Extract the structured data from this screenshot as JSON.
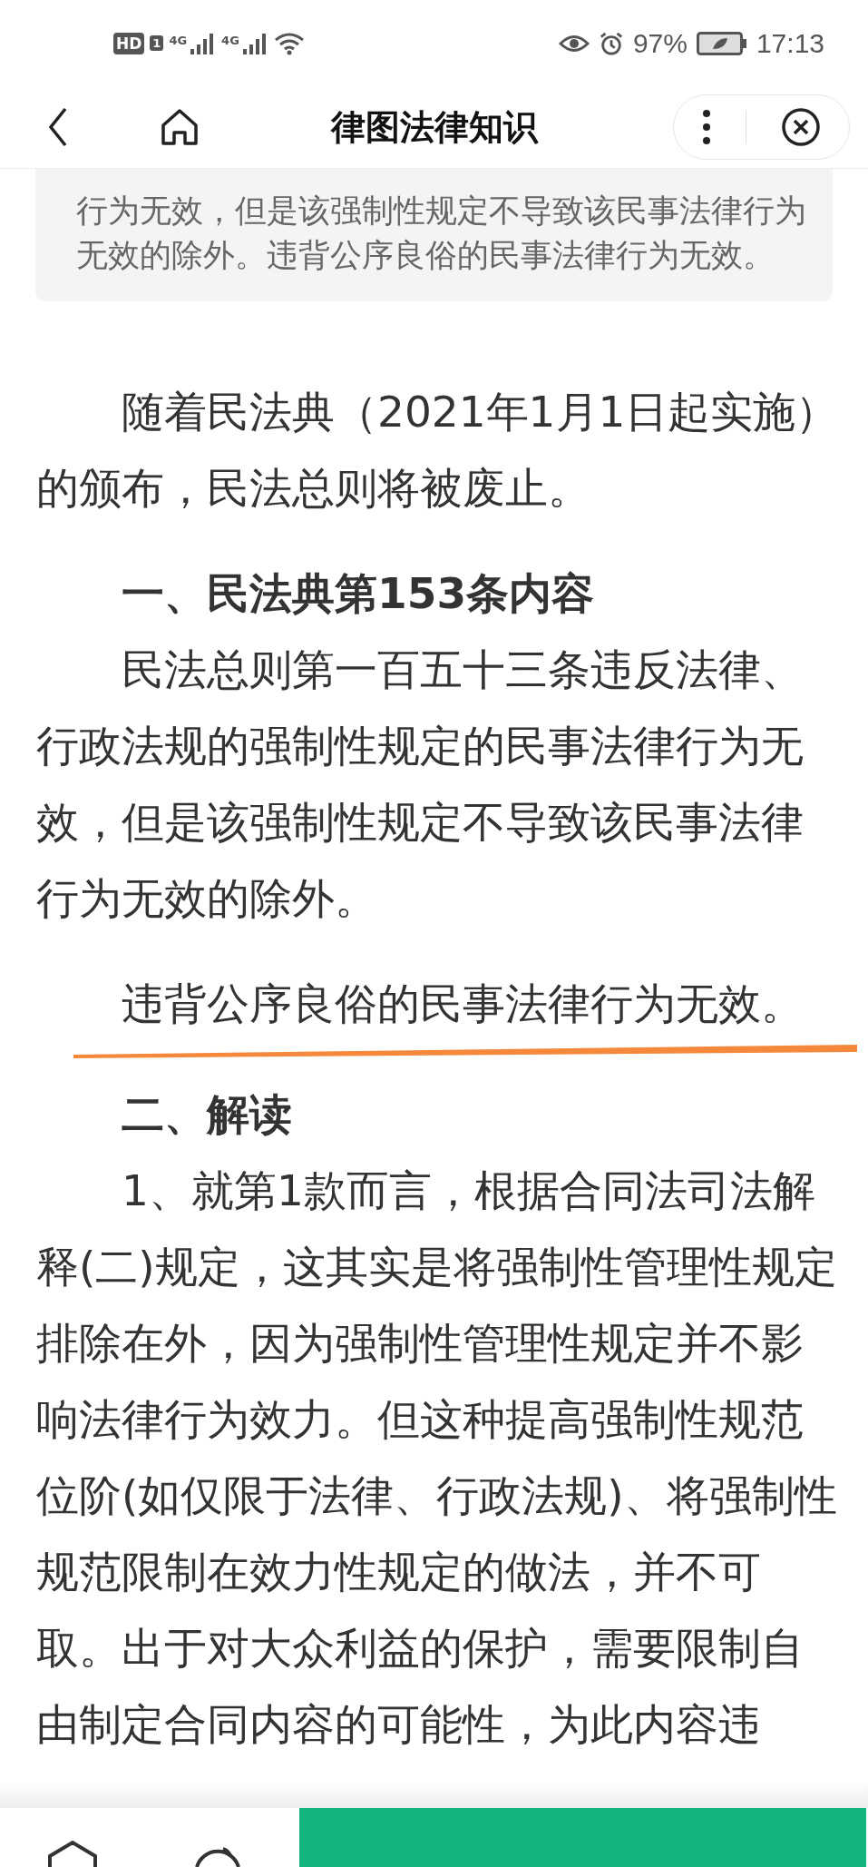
{
  "status_bar": {
    "hd": "HD",
    "sim": "1",
    "network_1": "4G",
    "network_2": "4G",
    "battery": "97%",
    "time": "17:13"
  },
  "header": {
    "title": "律图法律知识"
  },
  "summary": {
    "text": "行为无效，但是该强制性规定不导致该民事法律行为无效的除外。违背公序良俗的民事法律行为无效。"
  },
  "article": [
    {
      "kind": "paragraph",
      "text": "随着民法典（2021年1月1日起实施）的颁布，民法总则将被废止。",
      "underlined": false
    },
    {
      "kind": "heading",
      "text": "一、民法典第153条内容"
    },
    {
      "kind": "paragraph",
      "text": "民法总则第一百五十三条违反法律、行政法规的强制性规定的民事法律行为无效，但是该强制性规定不导致该民事法律行为无效的除外。",
      "underlined": false
    },
    {
      "kind": "paragraph",
      "text": "违背公序良俗的民事法律行为无效。",
      "underlined": true
    },
    {
      "kind": "heading",
      "text": "二、解读"
    },
    {
      "kind": "paragraph",
      "text": "1、就第1款而言，根据合同法司法解释(二)规定，这其实是将强制性管理性规定排除在外，因为强制性管理性规定并不影响法律行为效力。但这种提高强制性规范位阶(如仅限于法律、行政法规)、将强制性规范限制在效力性规定的做法，并不可取。出于对大众利益的保护，需要限制自由制定合同内容的可能性，为此内容违",
      "underlined": false
    }
  ]
}
